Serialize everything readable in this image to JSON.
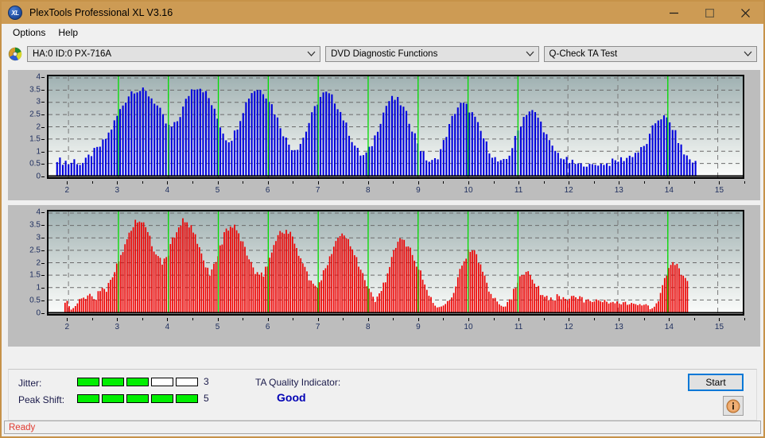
{
  "window": {
    "title": "PlexTools Professional XL V3.16",
    "app_icon": "xl-logo-icon",
    "minimize_label": "Minimize",
    "maximize_label": "Maximize",
    "close_label": "Close"
  },
  "menu": {
    "items": [
      {
        "label": "Options"
      },
      {
        "label": "Help"
      }
    ]
  },
  "toolbar": {
    "drive_icon": "optical-disc-icon",
    "drive_value": "HA:0 ID:0  PX-716A",
    "category_value": "DVD Diagnostic Functions",
    "test_value": "Q-Check TA Test"
  },
  "bottom": {
    "jitter_label": "Jitter:",
    "jitter_value": "3",
    "jitter_filled": 3,
    "jitter_total": 5,
    "peakshift_label": "Peak Shift:",
    "peakshift_value": "5",
    "peakshift_filled": 5,
    "peakshift_total": 5,
    "ta_title": "TA Quality Indicator:",
    "ta_value": "Good",
    "start_label": "Start",
    "info_label": "Info"
  },
  "statusbar": {
    "text": "Ready"
  },
  "colors": {
    "titlebar": "#cd9b54",
    "chart_blue": "#0000dd",
    "chart_red": "#ee0000",
    "marker_green": "#00dd00",
    "status_text": "#e03a30",
    "ta_good": "#0000b4",
    "meter_on": "#00ef00",
    "focus_border": "#0078d7"
  },
  "chart_data": [
    {
      "type": "bar",
      "name": "ta-shift-chart",
      "title": "",
      "xlabel": "",
      "ylabel": "",
      "series_color": "#0000dd",
      "marker_color": "#00dd00",
      "grid": true,
      "xlim": [
        1.6,
        15.5
      ],
      "ylim": [
        0,
        4
      ],
      "yticks": [
        0,
        0.5,
        1,
        1.5,
        2,
        2.5,
        3,
        3.5,
        4
      ],
      "ytick_labels": [
        "0",
        "0.5",
        "1",
        "1.5",
        "2",
        "2.5",
        "3",
        "3.5",
        "4"
      ],
      "xticks": [
        2,
        3,
        4,
        5,
        6,
        7,
        8,
        9,
        10,
        11,
        12,
        13,
        14,
        15
      ],
      "xtick_labels": [
        "2",
        "3",
        "4",
        "5",
        "6",
        "7",
        "8",
        "9",
        "10",
        "11",
        "12",
        "13",
        "14",
        "15"
      ],
      "markers": [
        3,
        4,
        5,
        6,
        7,
        8,
        9,
        10,
        11,
        14
      ],
      "bar_style": "spaced",
      "x": [
        1.72,
        1.79,
        1.86,
        1.93,
        2.0,
        2.07,
        2.14,
        2.21,
        2.28,
        2.35,
        2.42,
        2.49,
        2.56,
        2.63,
        2.7,
        2.77,
        2.84,
        2.91,
        2.98,
        3.05,
        3.12,
        3.19,
        3.26,
        3.33,
        3.4,
        3.47,
        3.54,
        3.61,
        3.68,
        3.75,
        3.82,
        3.89,
        3.96,
        4.03,
        4.1,
        4.17,
        4.24,
        4.31,
        4.38,
        4.45,
        4.52,
        4.59,
        4.66,
        4.73,
        4.8,
        4.87,
        4.94,
        5.01,
        5.08,
        5.15,
        5.22,
        5.29,
        5.36,
        5.43,
        5.5,
        5.57,
        5.64,
        5.71,
        5.78,
        5.85,
        5.92,
        5.99,
        6.06,
        6.13,
        6.2,
        6.27,
        6.34,
        6.41,
        6.48,
        6.55,
        6.62,
        6.69,
        6.76,
        6.83,
        6.9,
        6.97,
        7.04,
        7.11,
        7.18,
        7.25,
        7.32,
        7.39,
        7.46,
        7.53,
        7.6,
        7.67,
        7.74,
        7.81,
        7.88,
        7.95,
        8.02,
        8.09,
        8.16,
        8.23,
        8.3,
        8.37,
        8.44,
        8.51,
        8.58,
        8.65,
        8.72,
        8.79,
        8.86,
        8.93,
        9.0,
        9.07,
        9.14,
        9.21,
        9.28,
        9.35,
        9.42,
        9.49,
        9.56,
        9.63,
        9.7,
        9.77,
        9.84,
        9.91,
        9.98,
        10.05,
        10.12,
        10.19,
        10.26,
        10.33,
        10.4,
        10.47,
        10.54,
        10.61,
        10.68,
        10.75,
        10.82,
        10.89,
        10.96,
        11.03,
        11.1,
        11.17,
        11.24,
        11.31,
        11.38,
        11.45,
        11.52,
        11.59,
        11.66,
        11.8,
        11.95,
        12.1,
        12.4,
        12.8,
        13.2,
        13.5,
        13.62,
        13.69,
        13.76,
        13.83,
        13.9,
        13.97,
        14.04,
        14.11,
        14.18,
        14.25,
        14.32,
        14.45,
        14.6
      ],
      "y": [
        0.72,
        0.7,
        0.55,
        0.62,
        0.48,
        0.55,
        0.68,
        0.45,
        0.5,
        0.6,
        0.82,
        0.95,
        1.05,
        1.2,
        1.38,
        1.6,
        1.85,
        2.15,
        2.45,
        2.75,
        3.0,
        3.25,
        3.45,
        3.52,
        3.5,
        3.48,
        3.42,
        3.3,
        3.15,
        2.95,
        2.7,
        2.4,
        2.1,
        1.95,
        2.0,
        2.2,
        2.5,
        2.85,
        3.2,
        3.5,
        3.62,
        3.65,
        3.6,
        3.45,
        3.2,
        2.9,
        2.55,
        2.2,
        1.85,
        1.55,
        1.45,
        1.6,
        1.9,
        2.3,
        2.7,
        3.05,
        3.35,
        3.5,
        3.55,
        3.5,
        3.4,
        3.2,
        2.95,
        2.6,
        2.25,
        1.9,
        1.55,
        1.3,
        1.15,
        1.1,
        1.25,
        1.5,
        1.85,
        2.25,
        2.6,
        2.95,
        3.2,
        3.35,
        3.35,
        3.25,
        3.1,
        2.85,
        2.55,
        2.2,
        1.85,
        1.5,
        1.2,
        0.95,
        0.8,
        0.85,
        1.05,
        1.35,
        1.75,
        2.15,
        2.55,
        2.9,
        3.12,
        3.15,
        3.1,
        2.95,
        2.7,
        2.4,
        2.05,
        1.7,
        1.35,
        1.0,
        0.75,
        0.6,
        0.55,
        0.65,
        0.9,
        1.25,
        1.65,
        2.05,
        2.45,
        2.75,
        2.9,
        2.9,
        2.82,
        2.65,
        2.4,
        2.1,
        1.78,
        1.45,
        1.15,
        0.9,
        0.7,
        0.55,
        0.5,
        0.6,
        0.85,
        1.2,
        1.6,
        2.0,
        2.35,
        2.58,
        2.65,
        2.6,
        2.45,
        2.2,
        1.9,
        1.55,
        1.2,
        0.9,
        0.65,
        0.5,
        0.42,
        0.5,
        0.75,
        1.1,
        1.5,
        1.9,
        2.2,
        2.38,
        2.4,
        2.32,
        2.15,
        1.9,
        1.6,
        1.25,
        0.92,
        0.65,
        0.48,
        0.4,
        0.42,
        0.6,
        0.9,
        1.25,
        1.5,
        1.62,
        1.65,
        1.6,
        1.45,
        1.2,
        0.9,
        0.6,
        0.35,
        0.2,
        0.1,
        0.05,
        0.04,
        0.03,
        0.03,
        0.03,
        0.03,
        0.05,
        0.33,
        0.55,
        1.0,
        1.5,
        1.78,
        1.85,
        1.78,
        1.55,
        1.15,
        0.72,
        0.38,
        0.12,
        0.1
      ]
    },
    {
      "type": "bar",
      "name": "ta-jitter-chart",
      "title": "",
      "xlabel": "",
      "ylabel": "",
      "series_color": "#ee0000",
      "marker_color": "#00dd00",
      "grid": true,
      "xlim": [
        1.6,
        15.5
      ],
      "ylim": [
        0,
        4
      ],
      "yticks": [
        0,
        0.5,
        1,
        1.5,
        2,
        2.5,
        3,
        3.5,
        4
      ],
      "ytick_labels": [
        "0",
        "0.5",
        "1",
        "1.5",
        "2",
        "2.5",
        "3",
        "3.5",
        "4"
      ],
      "xticks": [
        2,
        3,
        4,
        5,
        6,
        7,
        8,
        9,
        10,
        11,
        12,
        13,
        14,
        15
      ],
      "xtick_labels": [
        "2",
        "3",
        "4",
        "5",
        "6",
        "7",
        "8",
        "9",
        "10",
        "11",
        "12",
        "13",
        "14",
        "15"
      ],
      "markers": [
        3,
        4,
        5,
        6,
        7,
        8,
        9,
        10,
        11,
        14
      ],
      "bar_style": "dense",
      "x": [
        1.9,
        1.97,
        2.04,
        2.11,
        2.18,
        2.25,
        2.32,
        2.39,
        2.46,
        2.53,
        2.6,
        2.67,
        2.74,
        2.81,
        2.88,
        2.95,
        3.02,
        3.09,
        3.16,
        3.23,
        3.3,
        3.37,
        3.44,
        3.51,
        3.58,
        3.65,
        3.72,
        3.79,
        3.86,
        3.93,
        4.0,
        4.07,
        4.14,
        4.21,
        4.28,
        4.35,
        4.42,
        4.49,
        4.56,
        4.63,
        4.7,
        4.77,
        4.84,
        4.91,
        4.98,
        5.05,
        5.12,
        5.19,
        5.26,
        5.33,
        5.4,
        5.47,
        5.54,
        5.61,
        5.68,
        5.75,
        5.82,
        5.89,
        5.96,
        6.03,
        6.1,
        6.17,
        6.24,
        6.31,
        6.38,
        6.45,
        6.52,
        6.59,
        6.66,
        6.73,
        6.8,
        6.87,
        6.94,
        7.01,
        7.08,
        7.15,
        7.22,
        7.29,
        7.36,
        7.43,
        7.5,
        7.57,
        7.64,
        7.71,
        7.78,
        7.85,
        7.92,
        7.99,
        8.06,
        8.13,
        8.2,
        8.27,
        8.34,
        8.41,
        8.48,
        8.55,
        8.62,
        8.69,
        8.76,
        8.83,
        8.9,
        8.97,
        9.04,
        9.11,
        9.18,
        9.25,
        9.32,
        9.39,
        9.46,
        9.6,
        9.72,
        9.79,
        9.86,
        9.93,
        10.0,
        10.07,
        10.14,
        10.21,
        10.28,
        10.35,
        10.42,
        10.55,
        10.7,
        10.85,
        10.95,
        11.02,
        11.09,
        11.16,
        11.23,
        11.3,
        11.37,
        11.5,
        13.55,
        13.7,
        13.8,
        13.87,
        13.94,
        14.01,
        14.08,
        14.15,
        14.25,
        14.4
      ],
      "y": [
        0.33,
        0.5,
        0.04,
        0.18,
        0.42,
        0.5,
        0.52,
        0.75,
        0.72,
        0.5,
        0.78,
        1.08,
        0.85,
        1.3,
        1.5,
        1.75,
        2.1,
        2.5,
        2.9,
        3.25,
        3.55,
        3.7,
        3.68,
        3.5,
        3.2,
        2.85,
        2.5,
        2.2,
        2.0,
        2.1,
        2.4,
        2.8,
        3.2,
        3.5,
        3.65,
        3.62,
        3.5,
        3.25,
        2.9,
        2.5,
        2.1,
        1.75,
        1.6,
        1.85,
        2.25,
        2.7,
        3.1,
        3.4,
        3.45,
        3.38,
        3.2,
        2.9,
        2.55,
        2.2,
        1.85,
        1.55,
        1.4,
        1.5,
        1.8,
        2.2,
        2.6,
        3.0,
        3.25,
        3.32,
        3.25,
        3.1,
        2.85,
        2.5,
        2.15,
        1.8,
        1.45,
        1.15,
        1.0,
        1.1,
        1.4,
        1.8,
        2.2,
        2.6,
        2.95,
        3.1,
        3.12,
        3.0,
        2.8,
        2.5,
        2.15,
        1.75,
        1.35,
        1.0,
        0.7,
        0.52,
        0.6,
        0.9,
        1.3,
        1.75,
        2.2,
        2.6,
        2.85,
        2.9,
        2.8,
        2.6,
        2.3,
        1.95,
        1.6,
        1.25,
        0.9,
        0.6,
        0.35,
        0.15,
        0.25,
        0.5,
        0.9,
        1.35,
        1.8,
        2.2,
        2.42,
        2.45,
        2.35,
        2.1,
        1.75,
        1.35,
        0.95,
        0.55,
        0.2,
        0.52,
        1.0,
        1.4,
        1.65,
        1.68,
        1.6,
        1.4,
        1.05,
        0.65,
        0.3,
        0.1,
        0.42,
        0.85,
        1.3,
        1.75,
        1.95,
        1.9,
        1.65,
        1.2,
        0.7,
        0.33
      ]
    }
  ]
}
